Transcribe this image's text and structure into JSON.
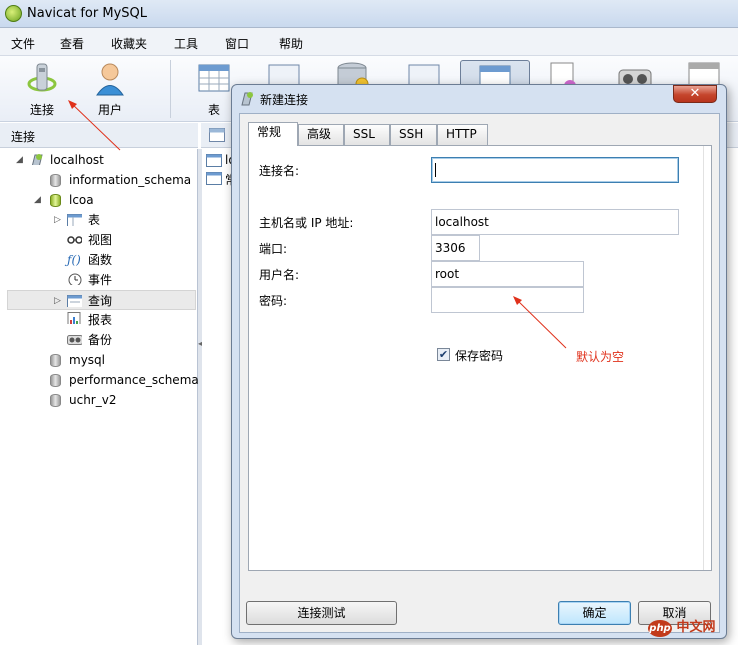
{
  "window": {
    "title": "Navicat for MySQL"
  },
  "menu": [
    "文件",
    "查看",
    "收藏夹",
    "工具",
    "窗口",
    "帮助"
  ],
  "toolbar": {
    "connect_label": "连接",
    "user_label": "用户",
    "table_label": "表"
  },
  "sidebar": {
    "header": "连接",
    "tree": {
      "localhost": "localhost",
      "information_schema": "information_schema",
      "lcoa": "lcoa",
      "lcoa_children": [
        "表",
        "视图",
        "函数",
        "事件",
        "查询",
        "报表",
        "备份"
      ],
      "mysql": "mysql",
      "performance_schema": "performance_schema",
      "uchr_v2": "uchr_v2"
    }
  },
  "right_pane": {
    "item1": "lo",
    "item2": "常"
  },
  "dialog": {
    "title": "新建连接",
    "close_glyph": "✕",
    "tabs": [
      "常规",
      "高级",
      "SSL",
      "SSH",
      "HTTP"
    ],
    "fields": {
      "connection_name": {
        "label": "连接名:",
        "value": ""
      },
      "host": {
        "label": "主机名或 IP 地址:",
        "value": "localhost"
      },
      "port": {
        "label": "端口:",
        "value": "3306"
      },
      "username": {
        "label": "用户名:",
        "value": "root"
      },
      "password": {
        "label": "密码:",
        "value": ""
      }
    },
    "save_password": {
      "label": "保存密码",
      "checked": true,
      "check_glyph": "✔"
    },
    "buttons": {
      "test": "连接测试",
      "ok": "确定",
      "cancel": "取消"
    }
  },
  "annotation": {
    "text": "默认为空",
    "color": "#e0311b"
  },
  "watermark": {
    "logo": "php",
    "text": "中文网"
  }
}
